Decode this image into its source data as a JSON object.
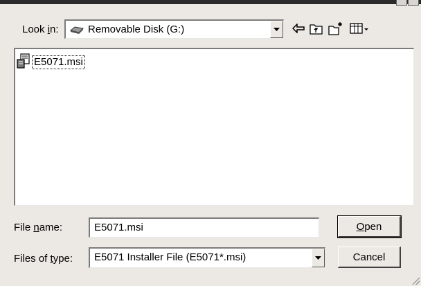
{
  "dialog": {
    "look_in": {
      "label_prefix": "Look ",
      "label_accel": "i",
      "label_suffix": "n:",
      "value": "Removable Disk (G:)"
    },
    "toolbar": {
      "icons": [
        "back-arrow-icon",
        "up-folder-icon",
        "new-folder-icon",
        "view-menu-icon"
      ]
    },
    "files": [
      {
        "name": "E5071.msi",
        "icon": "msi-installer-icon",
        "selected": true
      }
    ],
    "file_name": {
      "label_prefix": "File ",
      "label_accel": "n",
      "label_suffix": "ame:",
      "value": "E5071.msi"
    },
    "file_type": {
      "label_prefix": "Files of ",
      "label_accel": "t",
      "label_suffix": "ype:",
      "value": "E5071 Installer File (E5071*.msi)"
    },
    "buttons": {
      "open_accel": "O",
      "open_rest": "pen",
      "cancel": "Cancel"
    }
  }
}
